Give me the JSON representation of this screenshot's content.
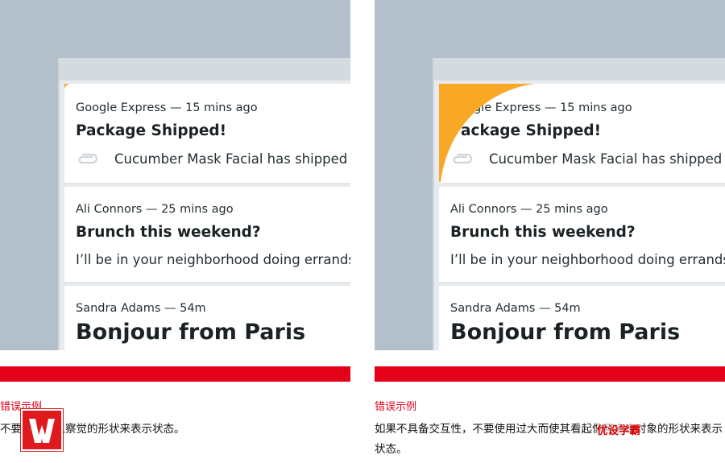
{
  "colors": {
    "accent_red": "#e5001a",
    "corner_orange": "#f9a825",
    "backdrop": "#b3bfca",
    "text_dark": "#1b2226"
  },
  "panels": [
    {
      "emails": [
        {
          "meta": "Google Express — 15 mins ago",
          "subject": "Package Shipped!",
          "preview": "Cucumber Mask Facial has shipped",
          "icon": "paperclip-icon"
        },
        {
          "meta": "Ali Connors — 25 mins ago",
          "subject": "Brunch this weekend?",
          "preview": "I’ll be in your neighborhood doing errands"
        },
        {
          "meta": "Sandra Adams — 54m",
          "subject": "Bonjour from Paris"
        }
      ],
      "label": "错误示例",
      "description": "不要使用难以察觉的形状来表示状态。",
      "corner": "small"
    },
    {
      "emails": [
        {
          "meta": "Google Express — 15 mins ago",
          "subject": "Package Shipped!",
          "preview": "Cucumber Mask Facial has shipped",
          "icon": "paperclip-icon"
        },
        {
          "meta": "Ali Connors — 25 mins ago",
          "subject": "Brunch this weekend?",
          "preview": "I’ll be in your neighborhood doing errands"
        },
        {
          "meta": "Sandra Adams — 54m",
          "subject": "Bonjour from Paris"
        }
      ],
      "label": "错误示例",
      "description": "如果不具备交互性，不要使用过大而使其看起像可点击对象的形状来表示状态。",
      "corner": "large"
    }
  ],
  "watermark": {
    "logo_letter": "W",
    "text": "优设学霸"
  }
}
